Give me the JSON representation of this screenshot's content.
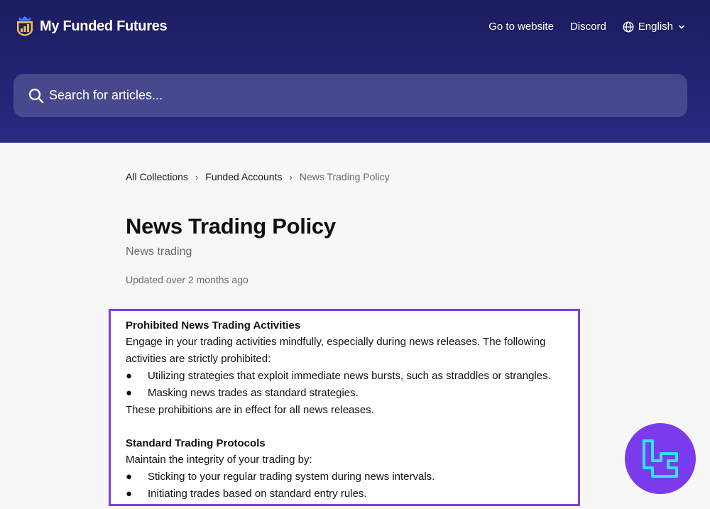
{
  "header": {
    "brand_name": "My Funded Futures",
    "nav": {
      "go_to_website": "Go to website",
      "discord": "Discord",
      "language": "English"
    },
    "search": {
      "placeholder": "Search for articles..."
    }
  },
  "breadcrumb": {
    "items": [
      "All Collections",
      "Funded Accounts",
      "News Trading Policy"
    ],
    "separator": "›"
  },
  "article": {
    "title": "News Trading Policy",
    "subtitle": "News trading",
    "updated": "Updated over 2 months ago",
    "sections": [
      {
        "heading": "Prohibited News Trading Activities",
        "intro": "Engage in your trading activities mindfully, especially during news releases. The following activities are strictly prohibited:",
        "bullets": [
          "Utilizing strategies that exploit immediate news bursts, such as straddles or strangles.",
          "Masking news trades as standard strategies."
        ],
        "outro": "These prohibitions are in effect for all news releases."
      },
      {
        "heading": "Standard Trading Protocols",
        "intro": "Maintain the integrity of your trading by:",
        "bullets": [
          "Sticking to your regular trading system during news intervals.",
          "Initiating trades based on standard entry rules."
        ]
      }
    ]
  },
  "colors": {
    "header_bg": "#232373",
    "highlight_border": "#7b3fe0",
    "badge_bg": "#7c3aed",
    "badge_logo": "#2ee6f0"
  },
  "icons": {
    "brand": "chart-shield-icon",
    "language": "globe-icon",
    "dropdown": "chevron-down-icon",
    "search": "search-icon",
    "bullet": "●",
    "badge": "tc-logo-icon"
  }
}
